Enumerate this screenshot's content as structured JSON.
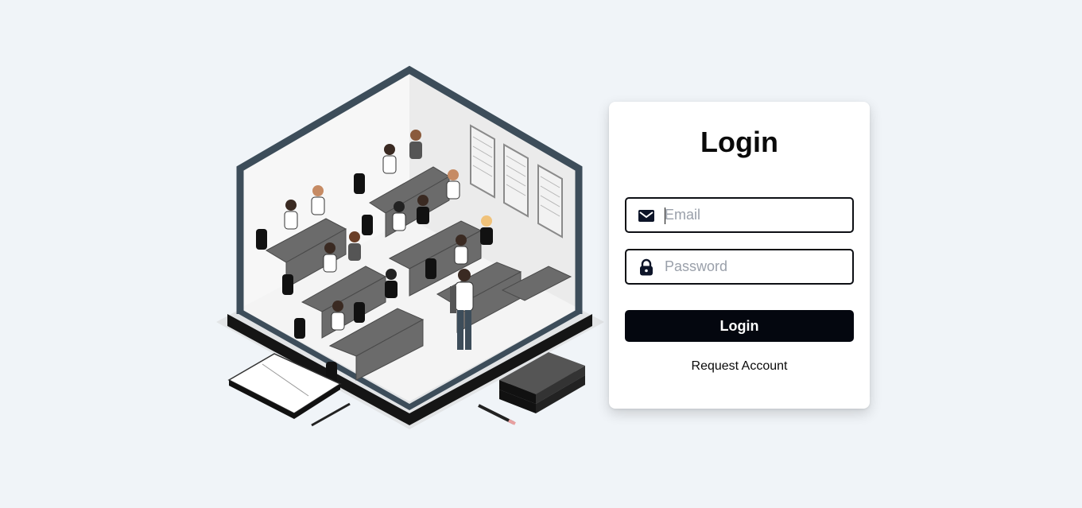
{
  "login_card": {
    "title": "Login",
    "email": {
      "placeholder": "Email",
      "value": "",
      "icon": "envelope-icon"
    },
    "password": {
      "placeholder": "Password",
      "value": "",
      "icon": "lock-icon"
    },
    "submit_label": "Login",
    "request_link_label": "Request Account"
  },
  "illustration": {
    "subject": "classroom-illustration"
  },
  "colors": {
    "page_background": "#f0f4f8",
    "card_background": "#ffffff",
    "button_background": "#04070f",
    "button_text": "#ffffff",
    "field_border": "#0d0f14",
    "placeholder": "#9aa0aa",
    "room_frame": "#3d4d5a"
  }
}
